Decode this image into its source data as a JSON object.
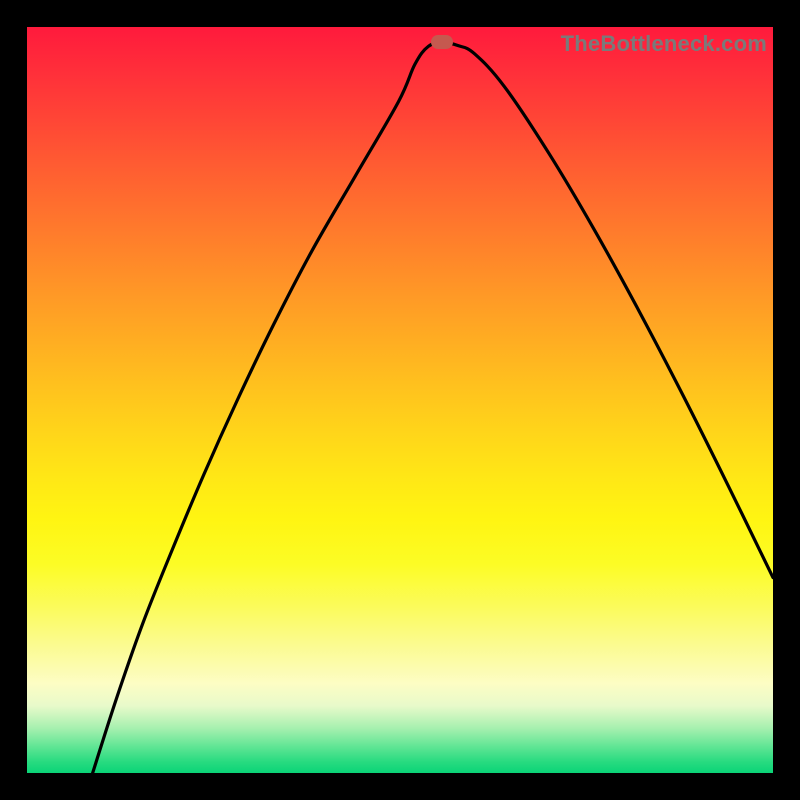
{
  "watermark": "TheBottleneck.com",
  "colors": {
    "marker": "#c5594f",
    "curve": "#000000"
  },
  "chart_data": {
    "type": "line",
    "title": "",
    "xlabel": "",
    "ylabel": "",
    "x_range_fraction": [
      0,
      1
    ],
    "y_range_fraction": [
      0,
      1
    ],
    "series": [
      {
        "name": "bottleneck-curve",
        "points_fraction_xy": [
          [
            0.088,
            0.0
          ],
          [
            0.12,
            0.1
          ],
          [
            0.155,
            0.2
          ],
          [
            0.195,
            0.3
          ],
          [
            0.237,
            0.4
          ],
          [
            0.282,
            0.5
          ],
          [
            0.33,
            0.6
          ],
          [
            0.382,
            0.7
          ],
          [
            0.44,
            0.8
          ],
          [
            0.498,
            0.9
          ],
          [
            0.52,
            0.95
          ],
          [
            0.538,
            0.974
          ],
          [
            0.558,
            0.979
          ],
          [
            0.578,
            0.975
          ],
          [
            0.6,
            0.964
          ],
          [
            0.64,
            0.92
          ],
          [
            0.7,
            0.83
          ],
          [
            0.76,
            0.729
          ],
          [
            0.82,
            0.62
          ],
          [
            0.88,
            0.505
          ],
          [
            0.94,
            0.385
          ],
          [
            1.0,
            0.262
          ]
        ]
      }
    ],
    "marker": {
      "x_fraction": 0.556,
      "y_fraction": 0.98
    }
  }
}
